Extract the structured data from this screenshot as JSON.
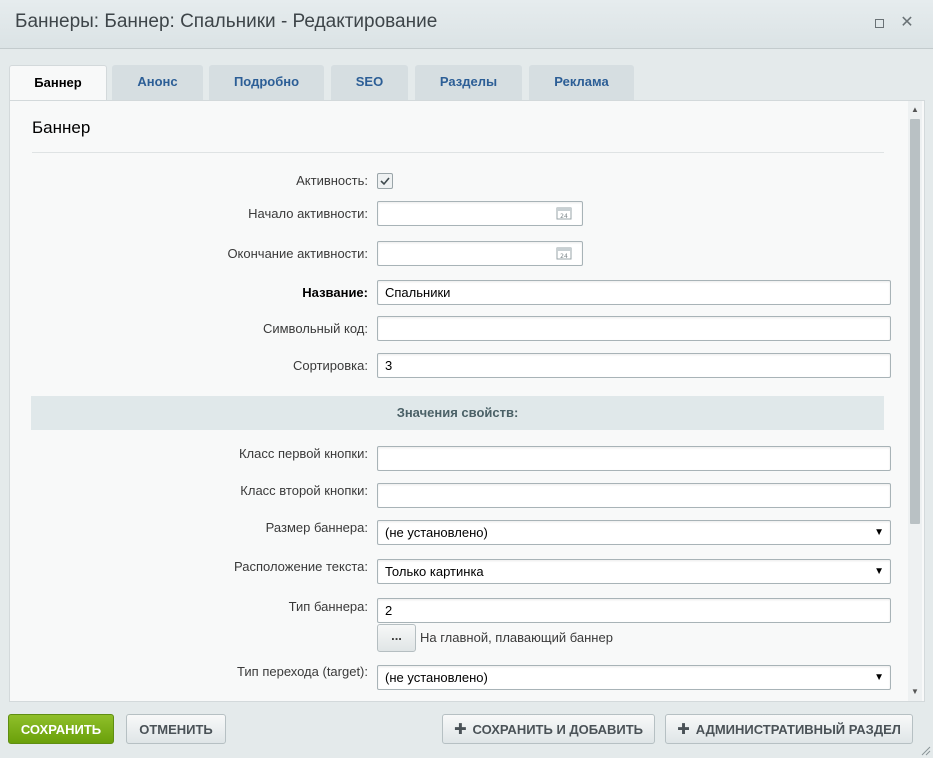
{
  "window": {
    "title": "Баннеры: Баннер: Спальники - Редактирование",
    "maximize_icon": "maximize-icon",
    "close_icon": "close-icon"
  },
  "tabs": [
    {
      "label": "Баннер",
      "active": true
    },
    {
      "label": "Анонс",
      "active": false
    },
    {
      "label": "Подробно",
      "active": false
    },
    {
      "label": "SEO",
      "active": false
    },
    {
      "label": "Разделы",
      "active": false
    },
    {
      "label": "Реклама",
      "active": false
    }
  ],
  "section": {
    "title": "Баннер"
  },
  "form": {
    "active": {
      "label": "Активность:",
      "checked": true
    },
    "date_start": {
      "label": "Начало активности:",
      "value": "",
      "icon": "calendar-icon"
    },
    "date_end": {
      "label": "Окончание активности:",
      "value": "",
      "icon": "calendar-icon"
    },
    "name": {
      "label": "Название:",
      "value": "Спальники"
    },
    "code": {
      "label": "Символьный код:",
      "value": ""
    },
    "sort": {
      "label": "Сортировка:",
      "value": "3"
    }
  },
  "properties": {
    "header": "Значения свойств:",
    "btn1_class": {
      "label": "Класс первой кнопки:",
      "value": ""
    },
    "btn2_class": {
      "label": "Класс второй кнопки:",
      "value": ""
    },
    "banner_size": {
      "label": "Размер баннера:",
      "value": "(не установлено)"
    },
    "text_position": {
      "label": "Расположение текста:",
      "value": "Только картинка"
    },
    "banner_type": {
      "label": "Тип баннера:",
      "value": "2",
      "button": "...",
      "note": "На главной, плавающий баннер"
    },
    "target": {
      "label": "Тип перехода (target):",
      "value": "(не установлено)"
    }
  },
  "footer": {
    "save": "СОХРАНИТЬ",
    "cancel": "ОТМЕНИТЬ",
    "save_add": "СОХРАНИТЬ И ДОБАВИТЬ",
    "admin": "АДМИНИСТРАТИВНЫЙ РАЗДЕЛ"
  },
  "colors": {
    "accent_green": "#7bb01a",
    "tab_link": "#2c5e96"
  }
}
